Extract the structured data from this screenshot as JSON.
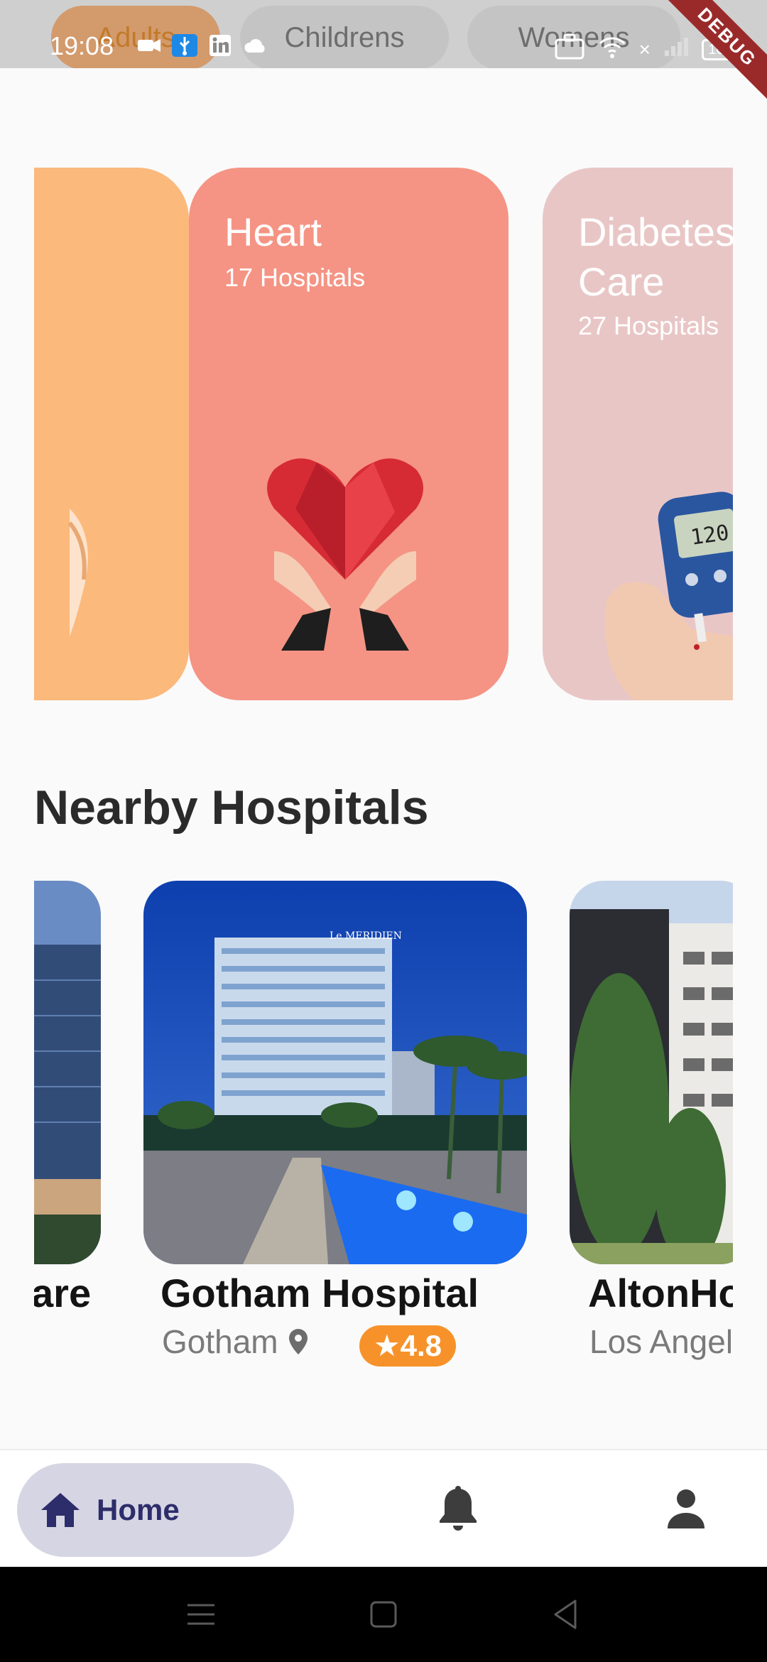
{
  "status_bar": {
    "time": "19:08",
    "battery": "100",
    "x_mark": "×"
  },
  "top_tabs": [
    {
      "label": "Adults"
    },
    {
      "label": "Childrens"
    },
    {
      "label": "Womens"
    }
  ],
  "debug_banner": "DEBUG",
  "categories": [
    {
      "title": "",
      "subtitle": "",
      "color": "#fbb97c"
    },
    {
      "title": "Heart",
      "subtitle": "17 Hospitals",
      "color": "#f59484"
    },
    {
      "title": "Diabetes Care",
      "subtitle": "27 Hospitals",
      "color": "#e9c6c6"
    }
  ],
  "nearby": {
    "title": "Nearby Hospitals",
    "hospitals": [
      {
        "name": "are",
        "location": ""
      },
      {
        "name": "Gotham Hospital",
        "location": "Gotham",
        "rating": "★4.8"
      },
      {
        "name": "AltonHo",
        "location": "Los Angel"
      }
    ]
  },
  "bottom_nav": {
    "home_label": "Home",
    "home_color": "#2d2d6b",
    "home_bg": "#d6d5e3"
  },
  "accent_colors": {
    "rating": "#f7922a"
  }
}
